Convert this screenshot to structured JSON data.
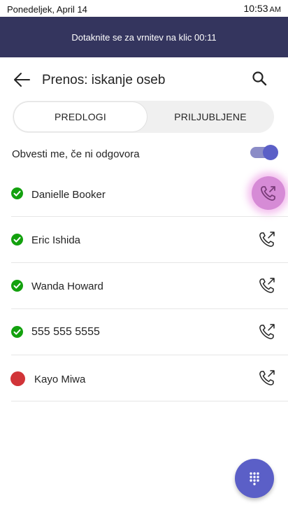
{
  "status_bar": {
    "date": "Ponedeljek, April 14",
    "time": "10:53",
    "ampm": "AM"
  },
  "banner": {
    "text": "Dotaknite se za vrnitev na klic 00:11"
  },
  "header": {
    "title": "Prenos: iskanje oseb",
    "back_icon": "arrow-left-icon",
    "search_icon": "search-icon"
  },
  "tabs": [
    {
      "label": "PREDLOGI",
      "selected": true
    },
    {
      "label": "PRILJUBLJENE",
      "selected": false
    }
  ],
  "notify": {
    "label": "Obvesti me, če ni odgovora",
    "enabled": true
  },
  "contacts": [
    {
      "name": "Danielle Booker",
      "presence": "available"
    },
    {
      "name": "Eric Ishida",
      "presence": "available"
    },
    {
      "name": "Wanda Howard",
      "presence": "available"
    },
    {
      "name": "555 555 5555",
      "presence": "available"
    },
    {
      "name": "Kayo Miwa",
      "presence": "busy"
    }
  ],
  "colors": {
    "banner": "#34355e",
    "accent": "#5b5fc7",
    "available": "#13a10e",
    "busy": "#d13438",
    "highlight": "#d68bd6"
  },
  "fab": {
    "icon": "dialpad-icon"
  }
}
